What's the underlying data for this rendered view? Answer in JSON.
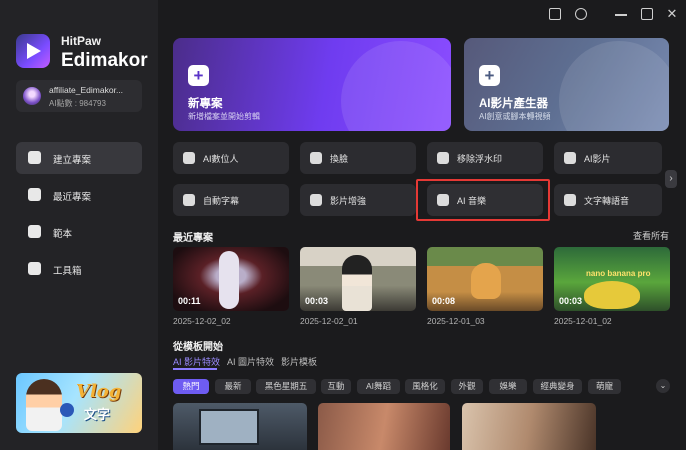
{
  "app": {
    "brand_small": "HitPaw",
    "brand_big": "Edimakor"
  },
  "account": {
    "name": "affiliate_Edimakor...",
    "credits": "AI點數 : 984793"
  },
  "sidebar": {
    "items": [
      {
        "label": "建立專案",
        "icon": "home-icon",
        "active": true
      },
      {
        "label": "最近專案",
        "icon": "folder-icon",
        "active": false
      },
      {
        "label": "範本",
        "icon": "template-icon",
        "active": false
      },
      {
        "label": "工具箱",
        "icon": "toolbox-icon",
        "active": false
      }
    ],
    "promo": {
      "title": "Vlog",
      "subtitle": "文字"
    }
  },
  "hero": {
    "new_project": {
      "title": "新專案",
      "subtitle": "新增檔案並開始剪輯"
    },
    "ai_video": {
      "title": "AI影片產生器",
      "subtitle": "AI創意或腳本轉視頻"
    }
  },
  "tools": [
    {
      "label": "AI數位人",
      "icon": "avatar-icon"
    },
    {
      "label": "換臉",
      "icon": "face-swap-icon"
    },
    {
      "label": "移除浮水印",
      "icon": "watermark-remove-icon"
    },
    {
      "label": "AI影片",
      "icon": "ai-video-icon"
    },
    {
      "label": "自動字幕",
      "icon": "captions-icon"
    },
    {
      "label": "影片增強",
      "icon": "enhance-icon"
    },
    {
      "label": "AI 音樂",
      "icon": "music-icon"
    },
    {
      "label": "文字轉語音",
      "icon": "tts-icon"
    }
  ],
  "recent": {
    "title": "最近專案",
    "see_all": "查看所有",
    "items": [
      {
        "duration": "00:11",
        "date": "2025-12-02_02"
      },
      {
        "duration": "00:03",
        "date": "2025-12-02_01"
      },
      {
        "duration": "00:08",
        "date": "2025-12-01_03"
      },
      {
        "duration": "00:03",
        "date": "2025-12-01_02",
        "caption": "nano banana pro"
      }
    ]
  },
  "templates": {
    "title": "從模板開始",
    "tabs": [
      "AI 影片特效",
      "AI 圖片特效",
      "影片模板"
    ],
    "chips": [
      "熱門",
      "最新",
      "黑色星期五",
      "互動",
      "AI舞蹈",
      "風格化",
      "外觀",
      "娛樂",
      "經典變身",
      "萌寵"
    ]
  },
  "colors": {
    "accent": "#6e5cf2",
    "highlight": "#e53935",
    "background": "#1b1b1d",
    "sidebar": "#232326"
  }
}
